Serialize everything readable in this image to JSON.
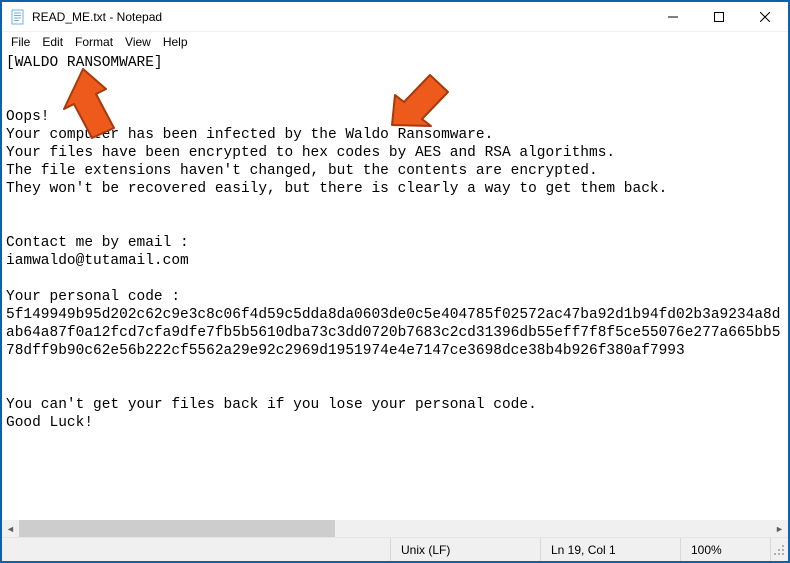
{
  "window": {
    "title": "READ_ME.txt - Notepad"
  },
  "menu": {
    "file": "File",
    "edit": "Edit",
    "format": "Format",
    "view": "View",
    "help": "Help"
  },
  "body_text": "[WALDO RANSOMWARE]\n\n\nOops!\nYour computer has been infected by the Waldo Ransomware.\nYour files have been encrypted to hex codes by AES and RSA algorithms.\nThe file extensions haven't changed, but the contents are encrypted.\nThey won't be recovered easily, but there is clearly a way to get them back.\n\n\nContact me by email :\niamwaldo@tutamail.com\n\nYour personal code :\n5f149949b95d202c62c9e3c8c06f4d59c5dda8da0603de0c5e404785f02572ac47ba92d1b94fd02b3a9234a8dab64a87f0a12fcd7cfa9dfe7fb5b5610dba73c3dd0720b7683c2cd31396db55eff7f8f5ce55076e277a665bb578dff9b90c62e56b222cf5562a29e92c2969d1951974e4e7147ce3698dce38b4b926f380af7993\n\n\nYou can't get your files back if you lose your personal code.\nGood Luck!",
  "status": {
    "encoding": "Unix (LF)",
    "position": "Ln 19, Col 1",
    "zoom": "100%"
  },
  "colors": {
    "window_border": "#0d62ab",
    "arrow": "#ee5a1b"
  }
}
